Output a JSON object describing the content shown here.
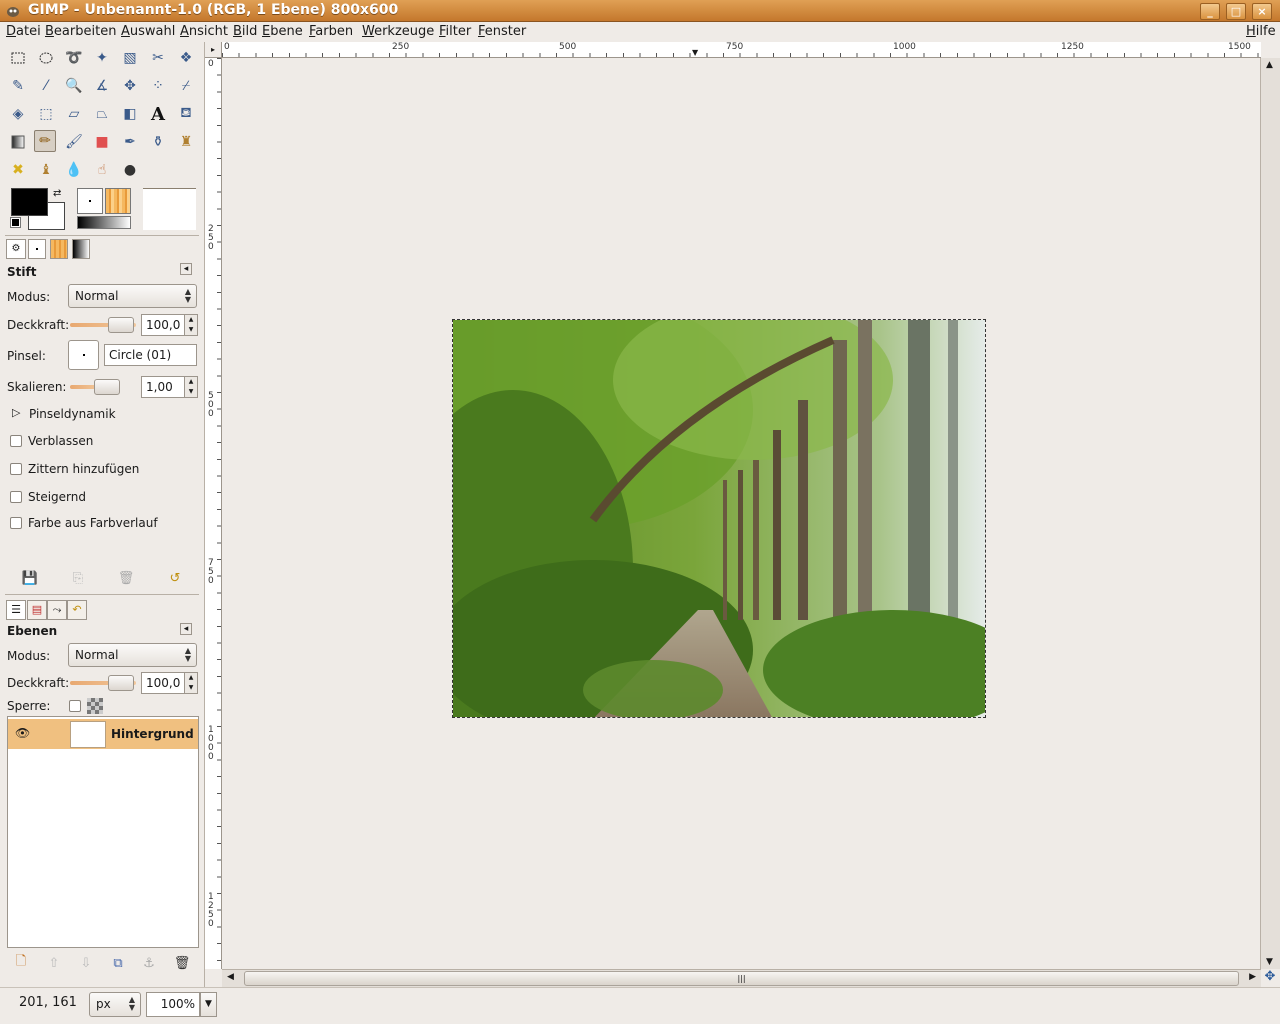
{
  "window": {
    "title": "GIMP - Unbenannt-1.0 (RGB, 1 Ebene) 800x600"
  },
  "menu": {
    "items": [
      "Datei",
      "Bearbeiten",
      "Auswahl",
      "Ansicht",
      "Bild",
      "Ebene",
      "Farben",
      "Werkzeuge",
      "Filter",
      "Fenster"
    ],
    "help": "Hilfe"
  },
  "tool_options": {
    "title": "Stift",
    "mode_label": "Modus:",
    "mode_value": "Normal",
    "opacity_label": "Deckkraft:",
    "opacity_value": "100,0",
    "opacity_fraction": 1.0,
    "brush_label": "Pinsel:",
    "brush_value": "Circle (01)",
    "scale_label": "Skalieren:",
    "scale_value": "1,00",
    "dynamics_label": "Pinseldynamik",
    "fade_label": "Verblassen",
    "jitter_label": "Zittern hinzufügen",
    "incremental_label": "Steigernd",
    "gradient_color_label": "Farbe aus Farbverlauf"
  },
  "layers": {
    "title": "Ebenen",
    "mode_label": "Modus:",
    "mode_value": "Normal",
    "opacity_label": "Deckkraft:",
    "opacity_value": "100,0",
    "lock_label": "Sperre:",
    "items": [
      {
        "name": "Hintergrund"
      }
    ]
  },
  "rulers": {
    "horizontal": [
      "0",
      "250",
      "500",
      "750",
      "1000",
      "1250",
      "1500"
    ],
    "vertical": [
      "0",
      "250",
      "500",
      "750",
      "1000",
      "1250"
    ]
  },
  "status": {
    "coords": "201, 161",
    "unit": "px",
    "zoom": "100%"
  },
  "colors": {
    "title_bar": "#c4772c",
    "accent": "#f0a850",
    "foreground": "#000000",
    "background": "#ffffff"
  }
}
